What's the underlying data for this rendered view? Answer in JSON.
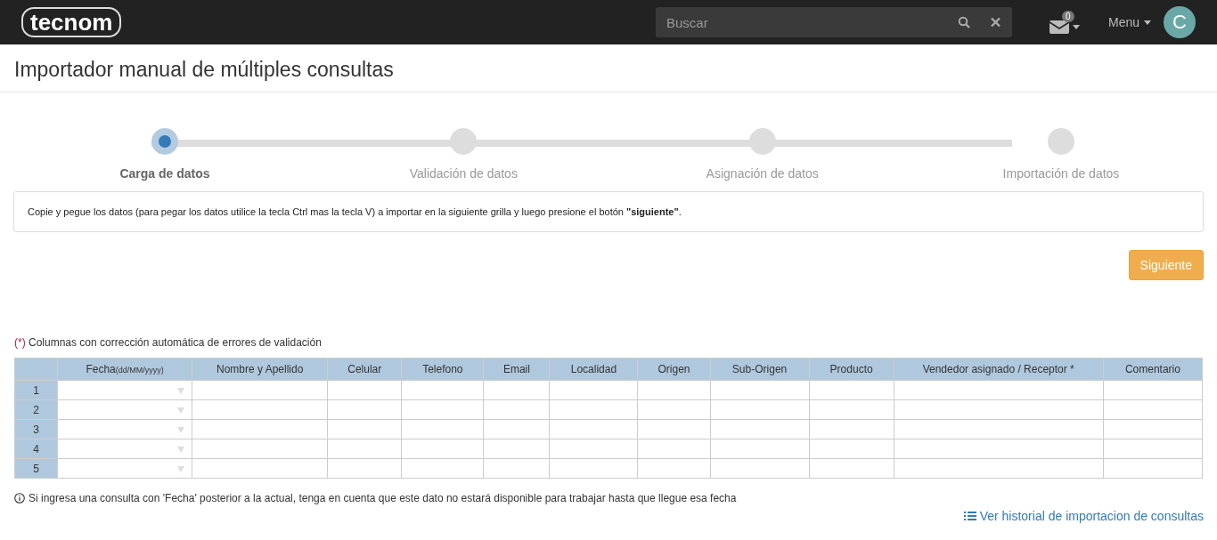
{
  "navbar": {
    "logo": "tecnom",
    "search": {
      "placeholder": "Buscar"
    },
    "mail_badge": "0",
    "menu": "Menu",
    "avatar": "C"
  },
  "page_title": "Importador manual de múltiples consultas",
  "steps": [
    {
      "label": "Carga de datos",
      "selected": true
    },
    {
      "label": "Validación de datos",
      "selected": false
    },
    {
      "label": "Asignación de datos",
      "selected": false
    },
    {
      "label": "Importación de datos",
      "selected": false
    }
  ],
  "instructions": "Copie y pegue los datos (para pegar los datos utilice la tecla Ctrl mas la tecla V) a importar en la siguiente grilla y luego presione el botón **\"siguiente\"**.",
  "next_button": "Siguiente",
  "legend": {
    "marker": "(*)",
    "text": "Columnas con corrección automática de errores de validación"
  },
  "table": {
    "columns": [
      {
        "label": "Fecha",
        "hint": "(dd/MM/yyyy)",
        "kind": "date"
      },
      {
        "label": "Nombre y Apellido",
        "kind": "text"
      },
      {
        "label": "Celular",
        "kind": "text"
      },
      {
        "label": "Telefono",
        "kind": "text"
      },
      {
        "label": "Email",
        "kind": "text"
      },
      {
        "label": "Localidad",
        "kind": "text"
      },
      {
        "label": "Origen",
        "kind": "text"
      },
      {
        "label": "Sub-Origen",
        "kind": "text"
      },
      {
        "label": "Producto",
        "kind": "text"
      },
      {
        "label": "Vendedor asignado / Receptor *",
        "kind": "text"
      },
      {
        "label": "Comentario",
        "kind": "text"
      }
    ],
    "rows": [
      {
        "number": "1"
      },
      {
        "number": "2"
      },
      {
        "number": "3"
      },
      {
        "number": "4"
      },
      {
        "number": "5"
      }
    ]
  },
  "note": "Si ingresa una consulta con 'Fecha' posterior a la actual, tenga en cuenta que este dato no estará disponible para trabajar hasta que llegue esa fecha",
  "history_link": "Ver historial de importacion de consultas"
}
